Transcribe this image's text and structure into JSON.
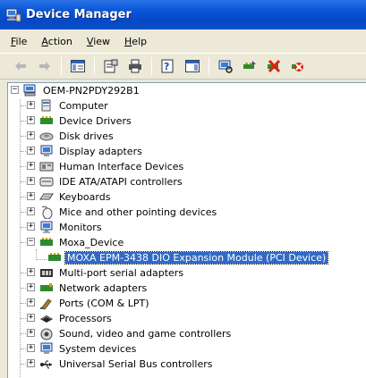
{
  "window": {
    "title": "Device Manager"
  },
  "menu": [
    {
      "label": "File",
      "underline": "F",
      "rest": "ile"
    },
    {
      "label": "Action",
      "underline": "A",
      "rest": "ction"
    },
    {
      "label": "View",
      "underline": "V",
      "rest": "iew"
    },
    {
      "label": "Help",
      "underline": "H",
      "rest": "elp"
    }
  ],
  "tree": {
    "root": "OEM-PN2PDY292B1",
    "categories": [
      {
        "label": "Computer",
        "icon": "computer-icon"
      },
      {
        "label": "Device Drivers",
        "icon": "device-drivers-icon"
      },
      {
        "label": "Disk drives",
        "icon": "disk-drive-icon"
      },
      {
        "label": "Display adapters",
        "icon": "display-adapter-icon"
      },
      {
        "label": "Human Interface Devices",
        "icon": "hid-icon"
      },
      {
        "label": "IDE ATA/ATAPI controllers",
        "icon": "ide-controller-icon"
      },
      {
        "label": "Keyboards",
        "icon": "keyboard-icon"
      },
      {
        "label": "Mice and other pointing devices",
        "icon": "mouse-icon"
      },
      {
        "label": "Monitors",
        "icon": "monitor-icon"
      },
      {
        "label": "Moxa_Device",
        "icon": "moxa-device-icon",
        "expanded": true
      },
      {
        "label": "Multi-port serial adapters",
        "icon": "multiport-serial-icon"
      },
      {
        "label": "Network adapters",
        "icon": "network-adapter-icon"
      },
      {
        "label": "Ports (COM & LPT)",
        "icon": "ports-icon"
      },
      {
        "label": "Processors",
        "icon": "processor-icon"
      },
      {
        "label": "Sound, video and game controllers",
        "icon": "sound-icon"
      },
      {
        "label": "System devices",
        "icon": "system-devices-icon"
      },
      {
        "label": "Universal Serial Bus controllers",
        "icon": "usb-icon"
      }
    ],
    "moxa_child": "MOXA EPM-3438 DIO Expansion Module (PCI Device)"
  }
}
